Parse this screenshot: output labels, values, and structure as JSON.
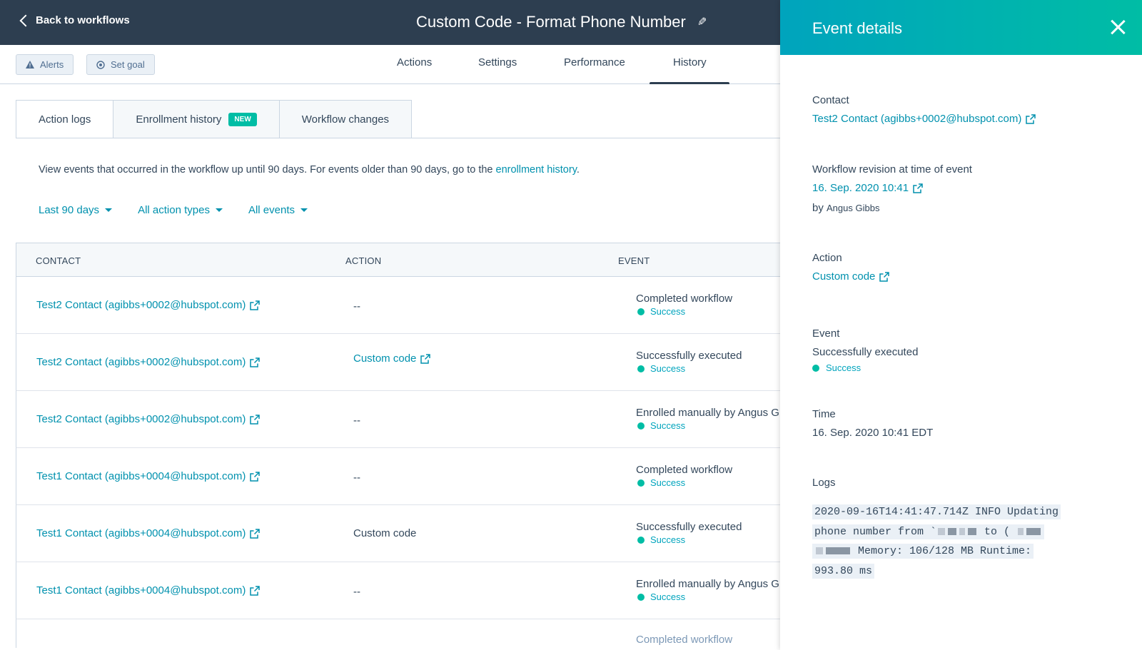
{
  "topbar": {
    "back_label": "Back to workflows",
    "title": "Custom Code - Format Phone Number"
  },
  "subnav": {
    "alerts_label": "Alerts",
    "set_goal_label": "Set goal",
    "tabs": [
      {
        "label": "Actions"
      },
      {
        "label": "Settings"
      },
      {
        "label": "Performance"
      },
      {
        "label": "History",
        "active": true
      }
    ]
  },
  "history_tabs": {
    "action_logs": "Action logs",
    "enrollment_history": "Enrollment history",
    "new_badge": "NEW",
    "workflow_changes": "Workflow changes"
  },
  "intro": {
    "text": "View events that occurred in the workflow up until 90 days. For events older than 90 days, go to the ",
    "link": "enrollment history",
    "suffix": "."
  },
  "filters": {
    "date": "Last 90 days",
    "action_types": "All action types",
    "events": "All events"
  },
  "table": {
    "headers": {
      "contact": "CONTACT",
      "action": "ACTION",
      "event": "EVENT"
    },
    "rows": [
      {
        "contact": "Test2 Contact (agibbs+0002@hubspot.com)",
        "action": "--",
        "event": "Completed workflow",
        "status": "Success"
      },
      {
        "contact": "Test2 Contact (agibbs+0002@hubspot.com)",
        "action": "Custom code",
        "event": "Successfully executed",
        "status": "Success"
      },
      {
        "contact": "Test2 Contact (agibbs+0002@hubspot.com)",
        "action": "--",
        "event": "Enrolled manually by Angus G",
        "status": "Success"
      },
      {
        "contact": "Test1 Contact (agibbs+0004@hubspot.com)",
        "action": "--",
        "event": "Completed workflow",
        "status": "Success"
      },
      {
        "contact": "Test1 Contact (agibbs+0004@hubspot.com)",
        "action": "Custom code",
        "event": "Successfully executed",
        "status": "Success"
      },
      {
        "contact": "Test1 Contact (agibbs+0004@hubspot.com)",
        "action": "--",
        "event": "Enrolled manually by Angus G",
        "status": "Success"
      },
      {
        "contact": "",
        "action": "",
        "event": "Completed workflow",
        "status": ""
      }
    ]
  },
  "panel": {
    "title": "Event details",
    "contact_label": "Contact",
    "contact_value": "Test2 Contact (agibbs+0002@hubspot.com)",
    "revision_label": "Workflow revision at time of event",
    "revision_value": "16. Sep. 2020 10:41",
    "revision_by_prefix": "by",
    "revision_by_name": "Angus Gibbs",
    "action_label": "Action",
    "action_value": "Custom code",
    "event_label": "Event",
    "event_value": "Successfully executed",
    "event_status": "Success",
    "time_label": "Time",
    "time_value": "16. Sep. 2020 10:41 EDT",
    "logs_label": "Logs",
    "logs_line1": "2020-09-16T14:41:47.714Z INFO Updating",
    "logs_line2a": "phone number from `",
    "logs_line2b": "to (",
    "logs_line3": "Memory: 106/128 MB Runtime:",
    "logs_line4": "993.80 ms"
  },
  "colors": {
    "topbar": "#2d3e50",
    "link": "#0091ae",
    "success": "#00bda5",
    "panel_header_start": "#00a4bd",
    "panel_header_end": "#00bda5"
  }
}
